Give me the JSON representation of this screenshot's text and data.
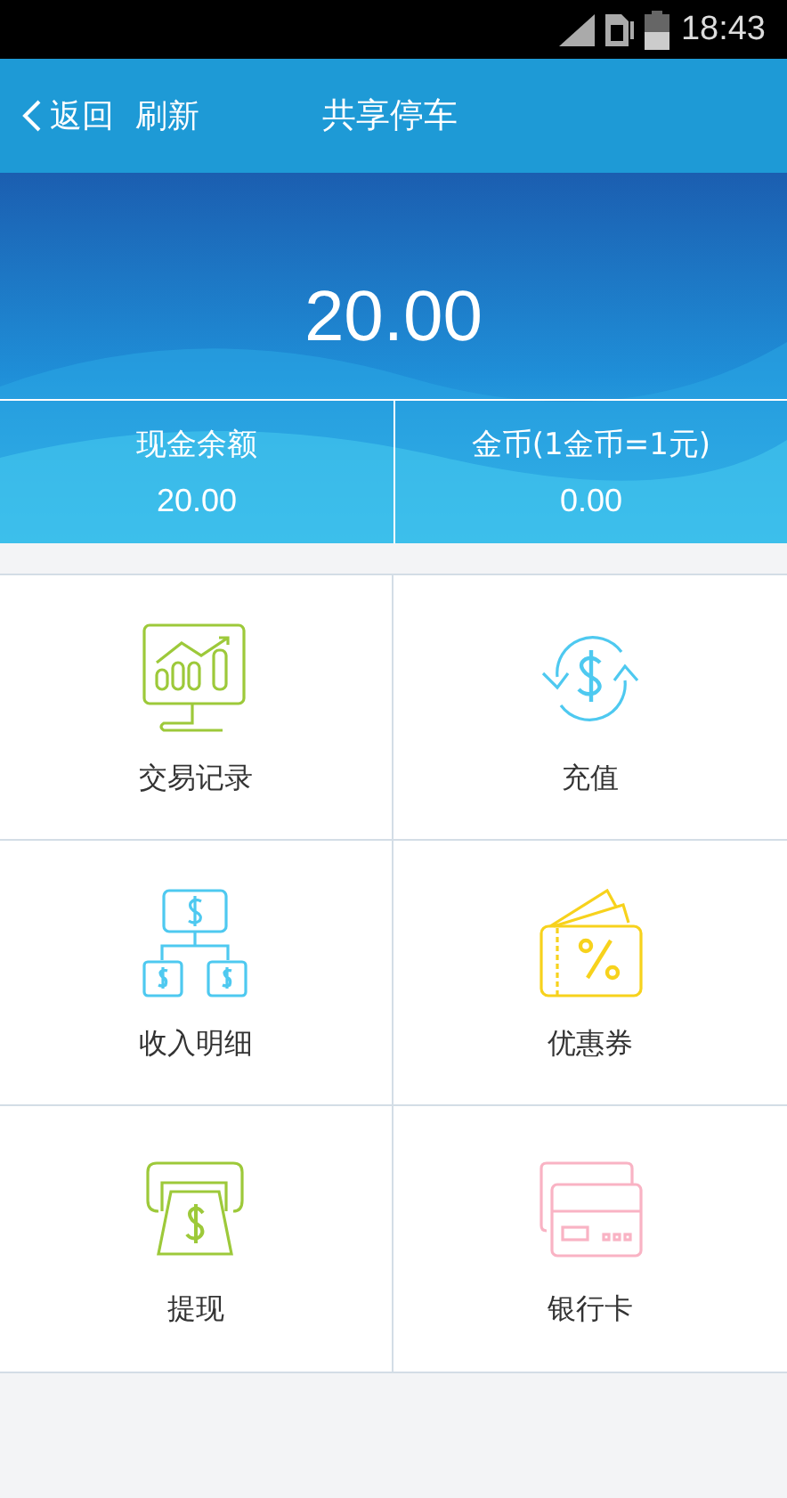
{
  "status_bar": {
    "time": "18:43"
  },
  "header": {
    "back": "返回",
    "refresh": "刷新",
    "title": "共享停车"
  },
  "balance": {
    "total": "20.00",
    "accounts": [
      {
        "label": "现金余额",
        "value": "20.00"
      },
      {
        "label": "金币(1金币=1元)",
        "value": "0.00"
      }
    ]
  },
  "menu": [
    {
      "kind": "chart",
      "label": "交易记录"
    },
    {
      "kind": "exchange",
      "label": "充值"
    },
    {
      "kind": "tree",
      "label": "收入明细"
    },
    {
      "kind": "coupon",
      "label": "优惠券"
    },
    {
      "kind": "atm",
      "label": "提现"
    },
    {
      "kind": "card",
      "label": "银行卡"
    }
  ]
}
